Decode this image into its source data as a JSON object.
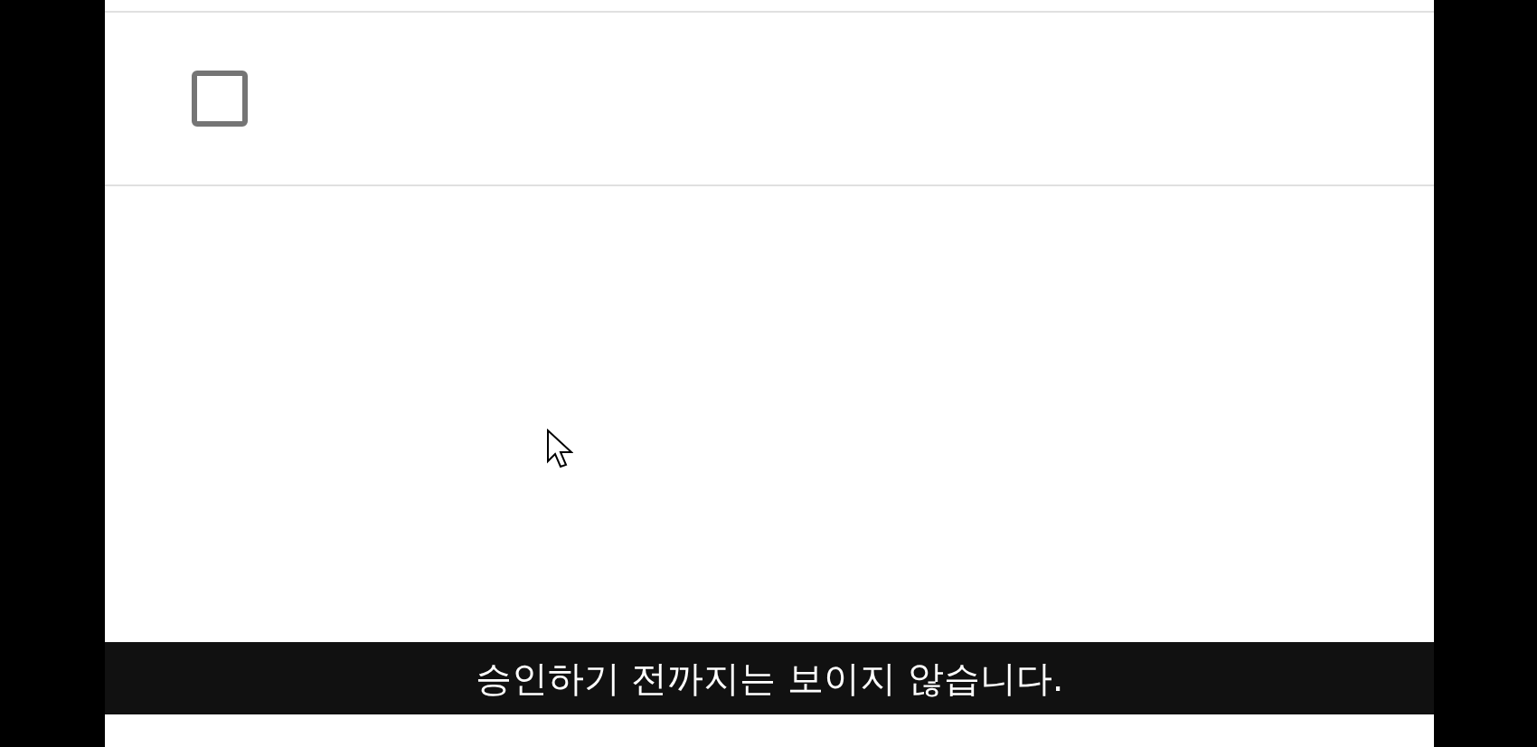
{
  "rows": [
    {
      "checked": false
    }
  ],
  "subtitle": "승인하기 전까지는 보이지 않습니다."
}
